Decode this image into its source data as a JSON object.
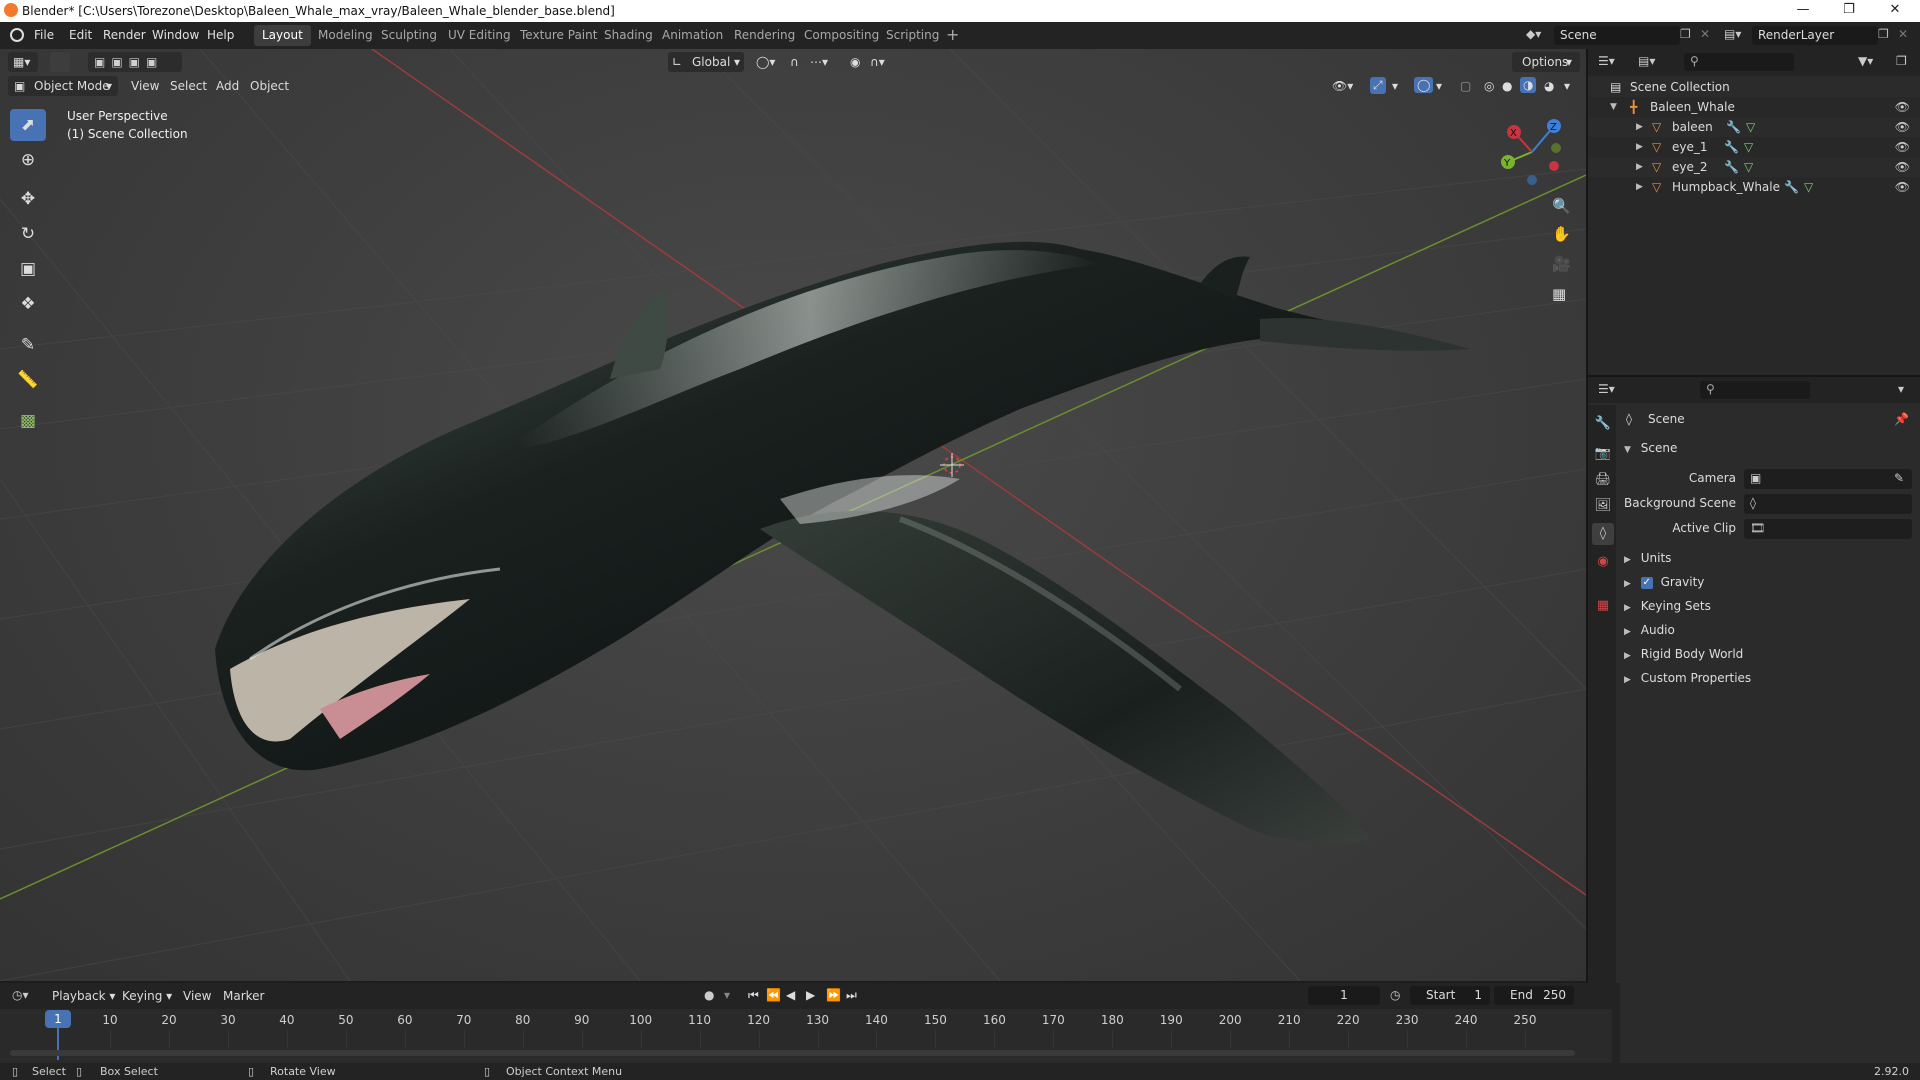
{
  "window": {
    "title": "Blender* [C:\\Users\\Torezone\\Desktop\\Baleen_Whale_max_vray/Baleen_Whale_blender_base.blend]"
  },
  "menu": [
    "File",
    "Edit",
    "Render",
    "Window",
    "Help"
  ],
  "workspaces": [
    "Layout",
    "Modeling",
    "Sculpting",
    "UV Editing",
    "Texture Paint",
    "Shading",
    "Animation",
    "Rendering",
    "Compositing",
    "Scripting"
  ],
  "active_workspace": "Layout",
  "top_right": {
    "scene": "Scene",
    "view_layer": "RenderLayer"
  },
  "viewport": {
    "mode": "Object Mode",
    "header_menus": [
      "View",
      "Select",
      "Add",
      "Object"
    ],
    "orientation": "Global",
    "options_label": "Options",
    "overlay_text": [
      "User Perspective",
      "(1) Scene Collection"
    ],
    "gizmo_axes": {
      "x": "X",
      "y": "Y",
      "z": "Z"
    }
  },
  "outliner": {
    "root": "Scene Collection",
    "collection": "Baleen_Whale",
    "objects": [
      "baleen",
      "eye_1",
      "eye_2",
      "Humpback_Whale"
    ]
  },
  "properties": {
    "context": "Scene",
    "panel_title": "Scene",
    "fields": [
      {
        "label": "Camera"
      },
      {
        "label": "Background Scene"
      },
      {
        "label": "Active Clip"
      }
    ],
    "subpanels": [
      "Units",
      "Gravity",
      "Keying Sets",
      "Audio",
      "Rigid Body World",
      "Custom Properties"
    ],
    "gravity_checked": true
  },
  "timeline": {
    "menus": [
      "Playback",
      "Keying",
      "View",
      "Marker"
    ],
    "current_frame": "1",
    "start_label": "Start",
    "start": "1",
    "end_label": "End",
    "end": "250",
    "frame_labels": [
      "1",
      "10",
      "20",
      "30",
      "40",
      "50",
      "60",
      "70",
      "80",
      "90",
      "100",
      "110",
      "120",
      "130",
      "140",
      "150",
      "160",
      "170",
      "180",
      "190",
      "200",
      "210",
      "220",
      "230",
      "240",
      "250"
    ]
  },
  "statusbar": {
    "items": [
      "Select",
      "Box Select",
      "Rotate View",
      "Object Context Menu"
    ],
    "version": "2.92.0"
  },
  "colors": {
    "accent": "#4772b3",
    "x_axis": "#c8343f",
    "y_axis": "#7ab32e",
    "z_axis": "#3d80d9",
    "object_orange": "#e6913a"
  }
}
